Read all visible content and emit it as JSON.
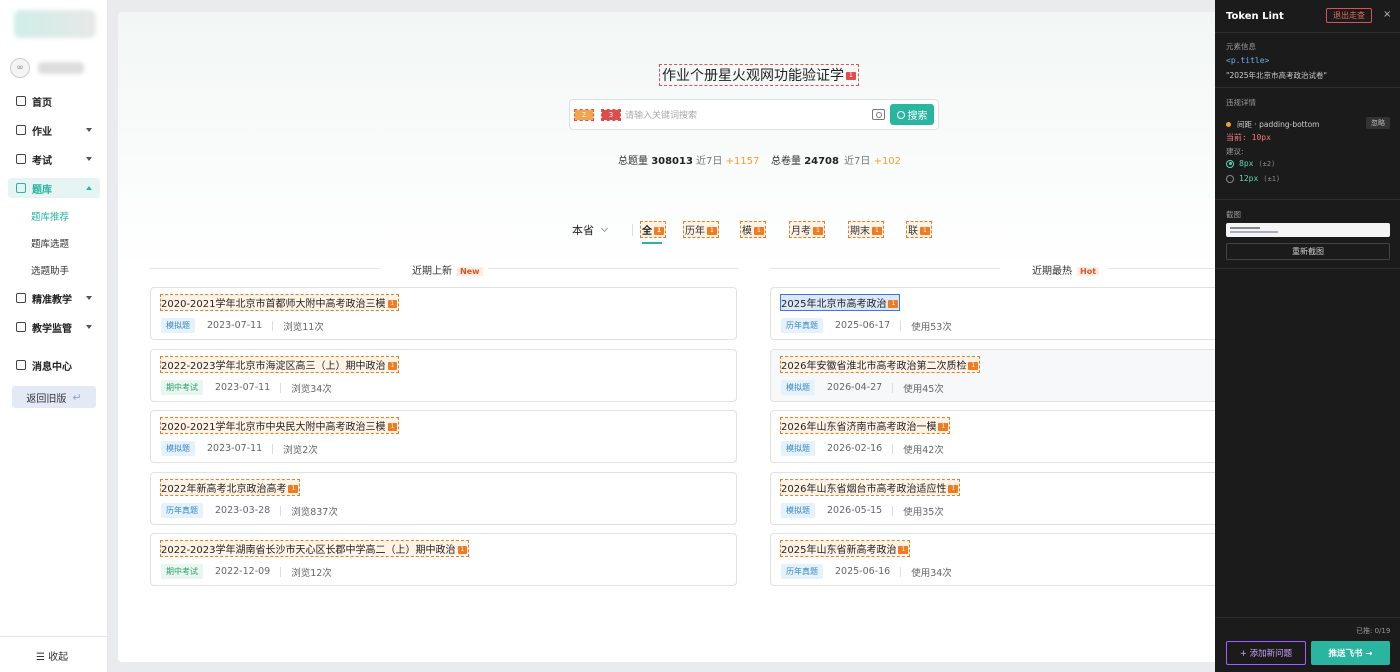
{
  "sidebar": {
    "nav": [
      {
        "label": "首页",
        "icon": "home-icon"
      },
      {
        "label": "作业",
        "icon": "homework-icon"
      },
      {
        "label": "考试",
        "icon": "exam-icon"
      },
      {
        "label": "题库",
        "icon": "question-bank-icon"
      },
      {
        "label": "精准教学",
        "icon": "target-icon"
      },
      {
        "label": "教学监管",
        "icon": "supervise-icon"
      },
      {
        "label": "消息中心",
        "icon": "message-icon"
      }
    ],
    "sub": [
      {
        "label": "题库推荐"
      },
      {
        "label": "题库选题"
      },
      {
        "label": "选题助手"
      }
    ],
    "back_label": "返回旧版",
    "collapse_label": "收起"
  },
  "main": {
    "title": "作业个册星火观网功能验证学",
    "title_token": "1",
    "search": {
      "token1": "2",
      "token2": "3",
      "placeholder": "请输入关键词搜索",
      "button": "搜索"
    },
    "stats": {
      "total_q_label": "总题量",
      "total_q": "308013",
      "q_recent_label": "近7日",
      "q_recent": "+1157",
      "total_p_label": "总卷量",
      "total_p": "24708",
      "p_recent_label": "近7日",
      "p_recent": "+102"
    },
    "province": "本省",
    "tabs": [
      {
        "label": "全",
        "token": "1"
      },
      {
        "label": "历年",
        "token": "1"
      },
      {
        "label": "模",
        "token": "1"
      },
      {
        "label": "月考",
        "token": "1"
      },
      {
        "label": "期末",
        "token": "1"
      },
      {
        "label": "联",
        "token": "1"
      }
    ],
    "latest": {
      "heading": "近期上新",
      "badge": "New",
      "cards": [
        {
          "title": "2020-2021学年北京市首都师大附中高考政治三模",
          "token": "1",
          "tag": "模拟题",
          "date": "2023-07-11",
          "count": "浏览11次"
        },
        {
          "title": "2022-2023学年北京市海淀区高三（上）期中政治",
          "token": "1",
          "tag": "期中考试",
          "date": "2023-07-11",
          "count": "浏览34次"
        },
        {
          "title": "2020-2021学年北京市中央民大附中高考政治三模",
          "token": "1",
          "tag": "模拟题",
          "date": "2023-07-11",
          "count": "浏览2次"
        },
        {
          "title": "2022年新高考北京政治高考",
          "token": "1",
          "tag": "历年真题",
          "date": "2023-03-28",
          "count": "浏览837次"
        },
        {
          "title": "2022-2023学年湖南省长沙市天心区长郡中学高二（上）期中政治",
          "token": "1",
          "tag": "期中考试",
          "date": "2022-12-09",
          "count": "浏览12次"
        }
      ]
    },
    "hot": {
      "heading": "近期最热",
      "badge": "Hot",
      "cards": [
        {
          "title": "2025年北京市高考政治",
          "token": "1",
          "tag": "历年真题",
          "date": "2025-06-17",
          "count": "使用53次"
        },
        {
          "title": "2026年安徽省淮北市高考政治第二次质检",
          "token": "1",
          "tag": "模拟题",
          "date": "2026-04-27",
          "count": "使用45次"
        },
        {
          "title": "2026年山东省济南市高考政治一模",
          "token": "1",
          "tag": "模拟题",
          "date": "2026-02-16",
          "count": "使用42次"
        },
        {
          "title": "2026年山东省烟台市高考政治适应性",
          "token": "1",
          "tag": "模拟题",
          "date": "2026-05-15",
          "count": "使用35次"
        },
        {
          "title": "2025年山东省新高考政治",
          "token": "1",
          "tag": "历年真题",
          "date": "2025-06-16",
          "count": "使用34次"
        }
      ]
    }
  },
  "panel": {
    "title": "Token Lint",
    "exit_label": "退出走查",
    "close_label": "×",
    "element_info_label": "元素信息",
    "element_selector": "<p.title>",
    "element_text": "\"2025年北京市高考政治试卷\"",
    "violation_label": "违规详情",
    "violation_name": "间距 · padding-bottom",
    "ignore_label": "忽略",
    "current_label": "当前: ",
    "current_value": "10px",
    "suggest_label": "建议:",
    "options": [
      {
        "value": "8px",
        "tol": "(±2)",
        "selected": true
      },
      {
        "value": "12px",
        "tol": "(±1)",
        "selected": false
      }
    ],
    "screenshot_label": "截图",
    "reshot_label": "重新截图",
    "pushed_label": "已推: 0/19",
    "add_label": "+ 添加新问题",
    "push_label": "推送飞书 →"
  },
  "colors": {
    "accent": "#2ab5a0",
    "token_orange": "#f07b22",
    "panel_bg": "#1b1b1b",
    "increase": "#f0a030"
  }
}
